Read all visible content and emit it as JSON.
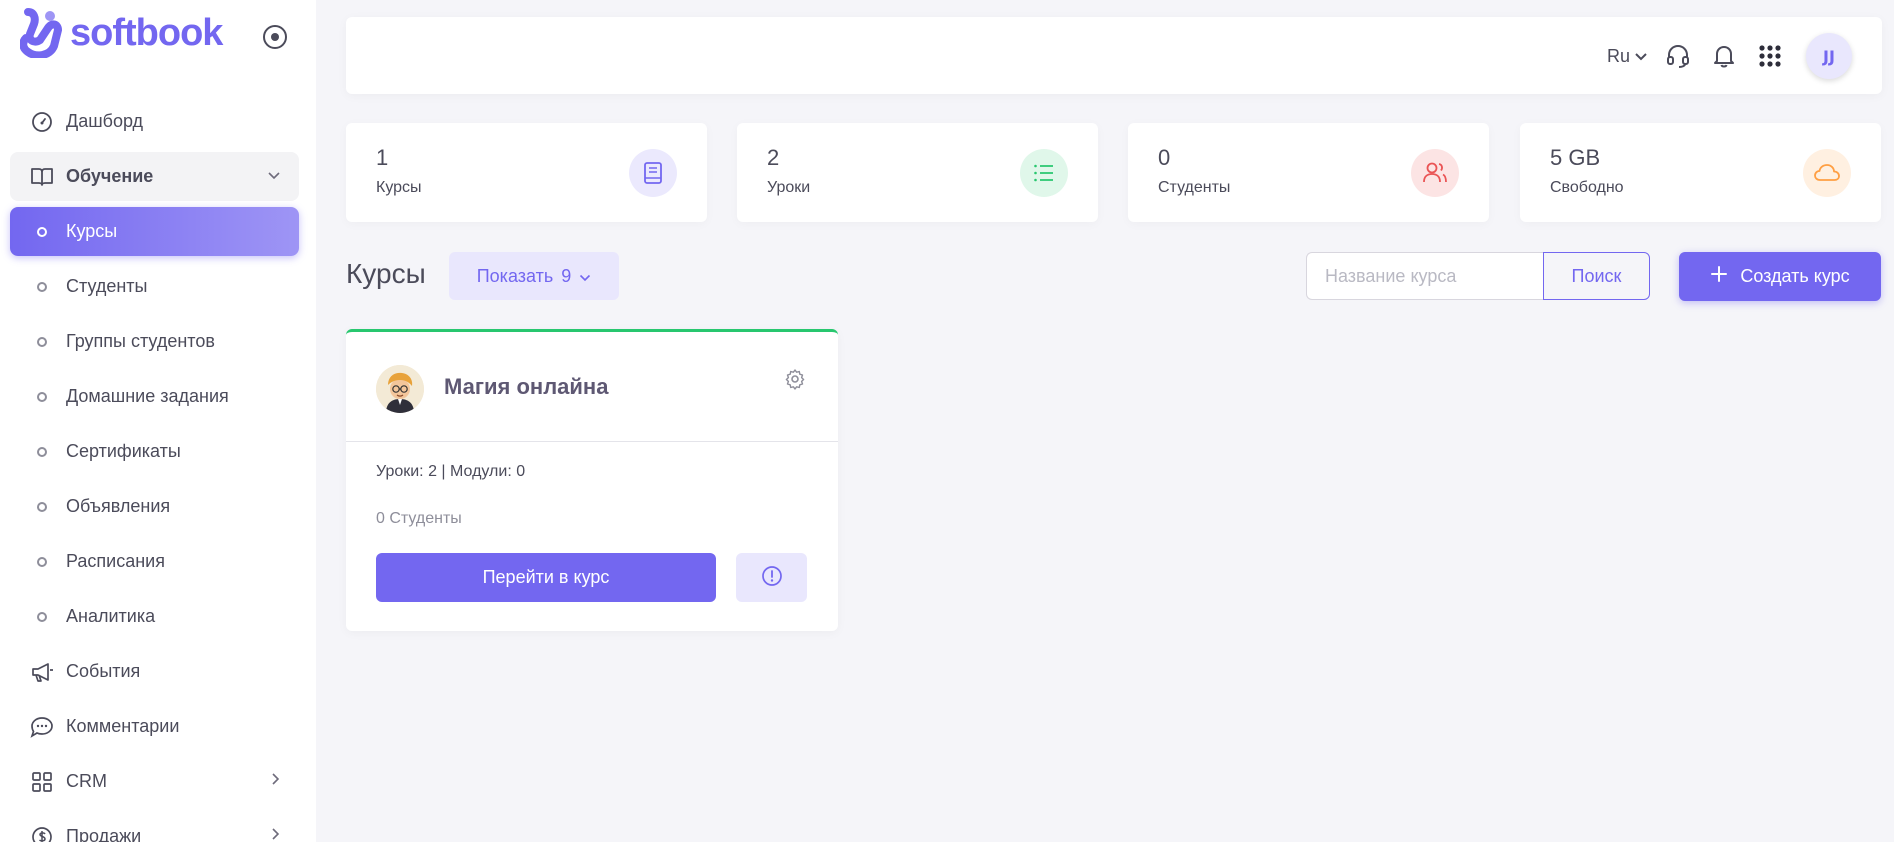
{
  "brand": {
    "name": "softbook",
    "accent": "#7367f0"
  },
  "sidebar": {
    "items": [
      {
        "label": "Дашборд",
        "icon": "gauge-icon"
      },
      {
        "label": "Обучение",
        "icon": "book-open-icon"
      },
      {
        "label": "Курсы"
      },
      {
        "label": "Студенты"
      },
      {
        "label": "Группы студентов"
      },
      {
        "label": "Домашние задания"
      },
      {
        "label": "Сертификаты"
      },
      {
        "label": "Объявления"
      },
      {
        "label": "Расписания"
      },
      {
        "label": "Аналитика"
      },
      {
        "label": "События",
        "icon": "megaphone-icon"
      },
      {
        "label": "Комментарии",
        "icon": "chat-icon"
      },
      {
        "label": "CRM",
        "icon": "grid-icon"
      },
      {
        "label": "Продажи",
        "icon": "dollar-icon"
      }
    ]
  },
  "topbar": {
    "language": "Ru",
    "avatar_initials": "JJ"
  },
  "stats": [
    {
      "value": "1",
      "label": "Курсы",
      "color": "#7367f0",
      "bg": "#ebe9fd",
      "icon": "book-icon"
    },
    {
      "value": "2",
      "label": "Уроки",
      "color": "#28c76f",
      "bg": "#e0f7ea",
      "icon": "list-icon"
    },
    {
      "value": "0",
      "label": "Студенты",
      "color": "#ea5455",
      "bg": "#fce4e4",
      "icon": "users-icon"
    },
    {
      "value": "5 GB",
      "label": "Свободно",
      "color": "#ff9f43",
      "bg": "#fff0e1",
      "icon": "cloud-icon"
    }
  ],
  "toolbar": {
    "title": "Курсы",
    "show_label": "Показать",
    "show_value": "9",
    "search_placeholder": "Название курса",
    "search_button": "Поиск",
    "create_button": "Создать курс"
  },
  "course": {
    "title": "Магия онлайна",
    "meta": "Уроки: 2 | Модули: 0",
    "students": "0 Студенты",
    "go_button": "Перейти в курс"
  }
}
